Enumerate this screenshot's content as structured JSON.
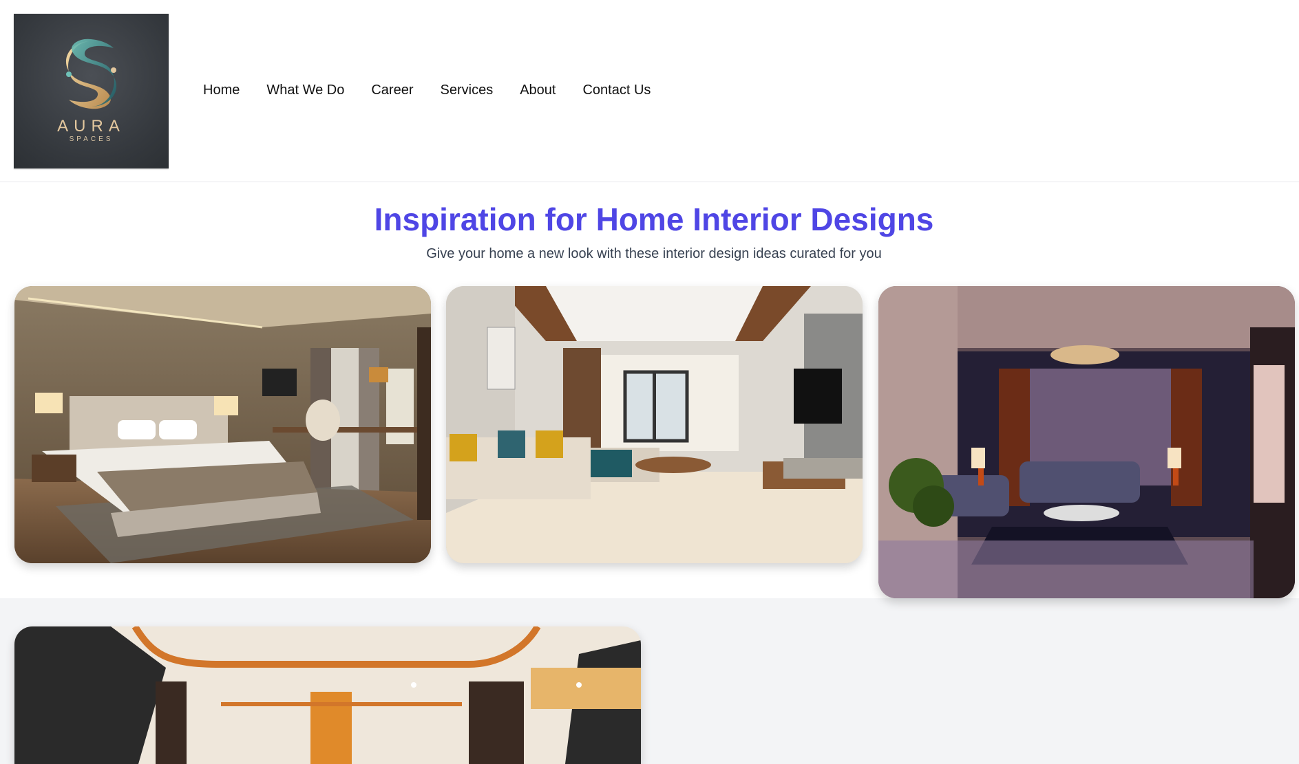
{
  "logo": {
    "wordmark": "AURA",
    "tagline": "SPACES"
  },
  "nav": {
    "items": [
      "Home",
      "What We Do",
      "Career",
      "Services",
      "About",
      "Contact Us"
    ]
  },
  "hero": {
    "title": "Inspiration for Home Interior Designs",
    "subtitle": "Give your home a new look with these interior design ideas curated for you"
  },
  "gallery": {
    "images": [
      "bedroom",
      "living-room-bright",
      "living-room-dark",
      "dining-room"
    ]
  },
  "colors": {
    "accent": "#4f46e5",
    "page_bg": "#f3f4f6"
  }
}
